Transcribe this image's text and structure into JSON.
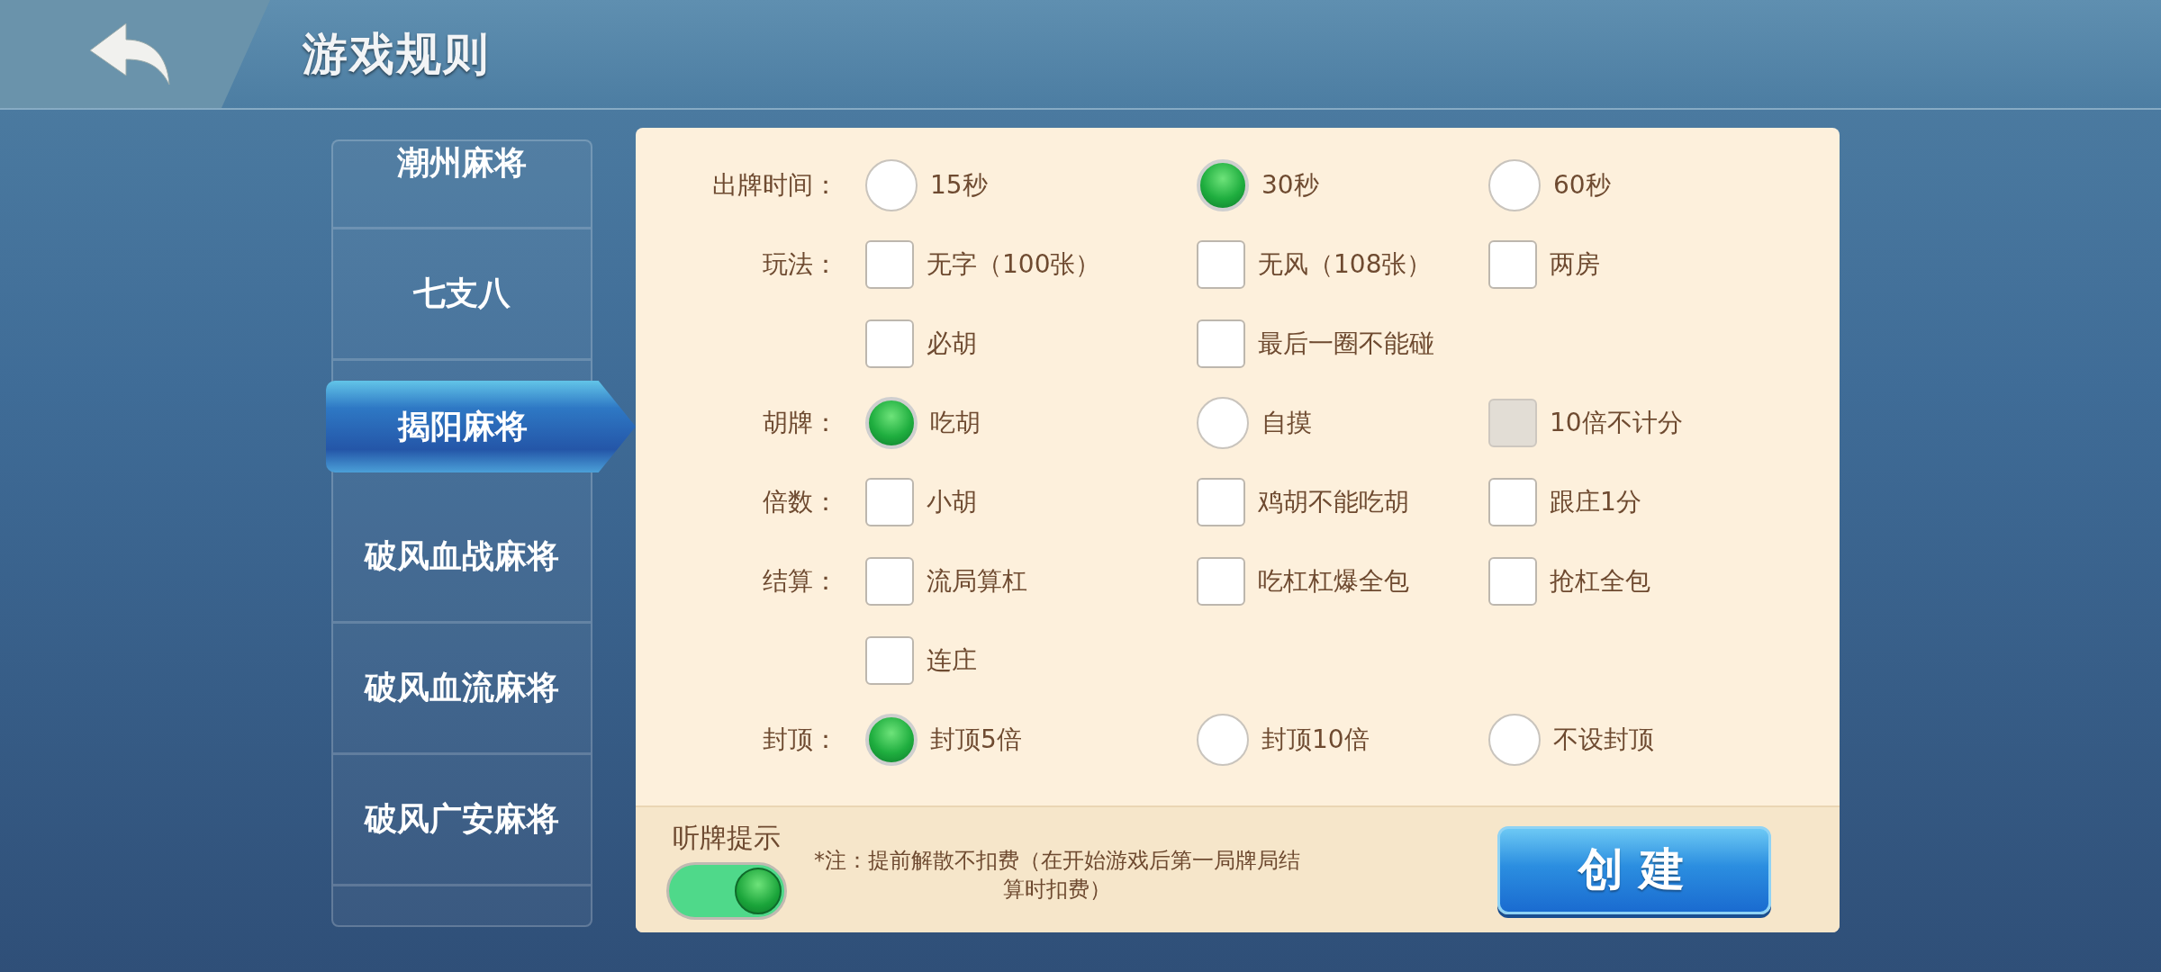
{
  "header": {
    "title": "游戏规则"
  },
  "sidebar": {
    "items": [
      {
        "label": "潮州麻将",
        "selected": false
      },
      {
        "label": "七支八",
        "selected": false
      },
      {
        "label": "揭阳麻将",
        "selected": true
      },
      {
        "label": "破风血战麻将",
        "selected": false
      },
      {
        "label": "破风血流麻将",
        "selected": false
      },
      {
        "label": "破风广安麻将",
        "selected": false
      }
    ]
  },
  "rules": [
    {
      "label": "出牌时间：",
      "options": [
        {
          "kind": "radio",
          "text": "15秒",
          "selected": false
        },
        {
          "kind": "radio",
          "text": "30秒",
          "selected": true
        },
        {
          "kind": "radio",
          "text": "60秒",
          "selected": false
        }
      ]
    },
    {
      "label": "玩法：",
      "options": [
        {
          "kind": "checkbox",
          "text": "无字（100张）",
          "checked": false,
          "disabled": false
        },
        {
          "kind": "checkbox",
          "text": "无风（108张）",
          "checked": false,
          "disabled": false
        },
        {
          "kind": "checkbox",
          "text": "两房",
          "checked": false,
          "disabled": false
        }
      ]
    },
    {
      "options": [
        {
          "kind": "checkbox",
          "text": "必胡",
          "checked": false,
          "disabled": false
        },
        {
          "kind": "checkbox",
          "text": "最后一圈不能碰",
          "checked": false,
          "disabled": false
        }
      ]
    },
    {
      "label": "胡牌：",
      "options": [
        {
          "kind": "radio",
          "text": "吃胡",
          "selected": true
        },
        {
          "kind": "radio",
          "text": "自摸",
          "selected": false
        },
        {
          "kind": "checkbox",
          "text": "10倍不计分",
          "checked": false,
          "disabled": true
        }
      ]
    },
    {
      "label": "倍数：",
      "options": [
        {
          "kind": "checkbox",
          "text": "小胡",
          "checked": false,
          "disabled": false
        },
        {
          "kind": "checkbox",
          "text": "鸡胡不能吃胡",
          "checked": false,
          "disabled": false
        },
        {
          "kind": "checkbox",
          "text": "跟庄1分",
          "checked": false,
          "disabled": false
        }
      ]
    },
    {
      "label": "结算：",
      "options": [
        {
          "kind": "checkbox",
          "text": "流局算杠",
          "checked": false,
          "disabled": false
        },
        {
          "kind": "checkbox",
          "text": "吃杠杠爆全包",
          "checked": false,
          "disabled": false
        },
        {
          "kind": "checkbox",
          "text": "抢杠全包",
          "checked": false,
          "disabled": false
        }
      ]
    },
    {
      "options": [
        {
          "kind": "checkbox",
          "text": "连庄",
          "checked": false,
          "disabled": false
        }
      ]
    },
    {
      "label": "封顶：",
      "options": [
        {
          "kind": "radio",
          "text": "封顶5倍",
          "selected": true
        },
        {
          "kind": "radio",
          "text": "封顶10倍",
          "selected": false
        },
        {
          "kind": "radio",
          "text": "不设封顶",
          "selected": false
        }
      ]
    }
  ],
  "footer": {
    "toggle": {
      "label": "听牌提示",
      "on": true
    },
    "note": "*注：提前解散不扣费（在开始游戏后第一局牌局结算时扣费）",
    "button": "创建"
  }
}
